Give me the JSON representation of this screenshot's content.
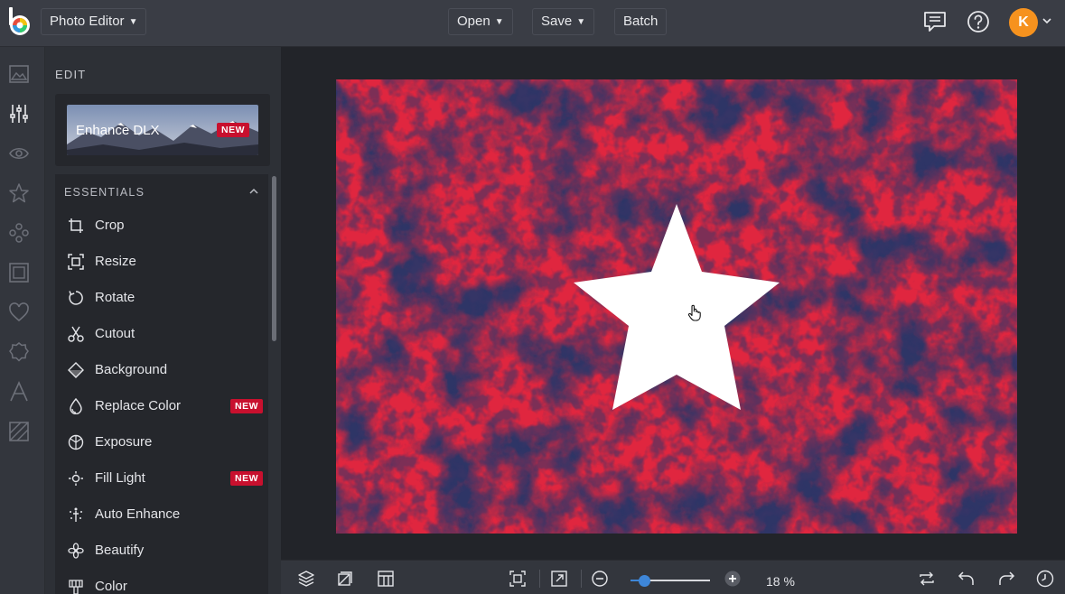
{
  "app": {
    "brand_letter": "b"
  },
  "header": {
    "app_mode_label": "Photo Editor",
    "open_label": "Open",
    "save_label": "Save",
    "batch_label": "Batch",
    "user_initial": "K",
    "icons": [
      "comments-icon",
      "help-icon",
      "chevron-down-icon"
    ]
  },
  "rail": {
    "items": [
      "photo-icon",
      "sliders-icon",
      "eye-icon",
      "star-icon",
      "components-icon",
      "frame-icon",
      "heart-icon",
      "badge-icon",
      "text-icon",
      "texture-icon"
    ],
    "active": "sliders-icon"
  },
  "panel": {
    "section_title": "EDIT",
    "enhance": {
      "label": "Enhance DLX",
      "badge": "NEW"
    },
    "essentials": {
      "header": "ESSENTIALS",
      "tools": [
        {
          "label": "Crop",
          "icon": "crop-icon",
          "badge": ""
        },
        {
          "label": "Resize",
          "icon": "resize-icon",
          "badge": ""
        },
        {
          "label": "Rotate",
          "icon": "rotate-icon",
          "badge": ""
        },
        {
          "label": "Cutout",
          "icon": "scissors-icon",
          "badge": ""
        },
        {
          "label": "Background",
          "icon": "background-icon",
          "badge": ""
        },
        {
          "label": "Replace Color",
          "icon": "droplet-icon",
          "badge": "NEW"
        },
        {
          "label": "Exposure",
          "icon": "exposure-icon",
          "badge": ""
        },
        {
          "label": "Fill Light",
          "icon": "sun-icon",
          "badge": "NEW"
        },
        {
          "label": "Auto Enhance",
          "icon": "auto-enhance-icon",
          "badge": ""
        },
        {
          "label": "Beautify",
          "icon": "beautify-icon",
          "badge": ""
        },
        {
          "label": "Color",
          "icon": "color-icon",
          "badge": ""
        }
      ]
    }
  },
  "canvas": {
    "photo_color": "#e0263f",
    "shadow_color": "#2d3566",
    "shape": "star"
  },
  "bottom": {
    "zoom": {
      "percent": 18,
      "label": "18 %"
    },
    "icons": [
      "layers-icon",
      "artboard-icon",
      "layout-icon",
      "fit-screen-icon",
      "expand-icon",
      "zoom-out-icon",
      "zoom-in-icon",
      "flip-icon",
      "undo-icon",
      "redo-icon",
      "history-icon"
    ]
  },
  "colors": {
    "accent": "#3e86d8",
    "badge": "#c8102e",
    "avatar": "#f6921e"
  }
}
